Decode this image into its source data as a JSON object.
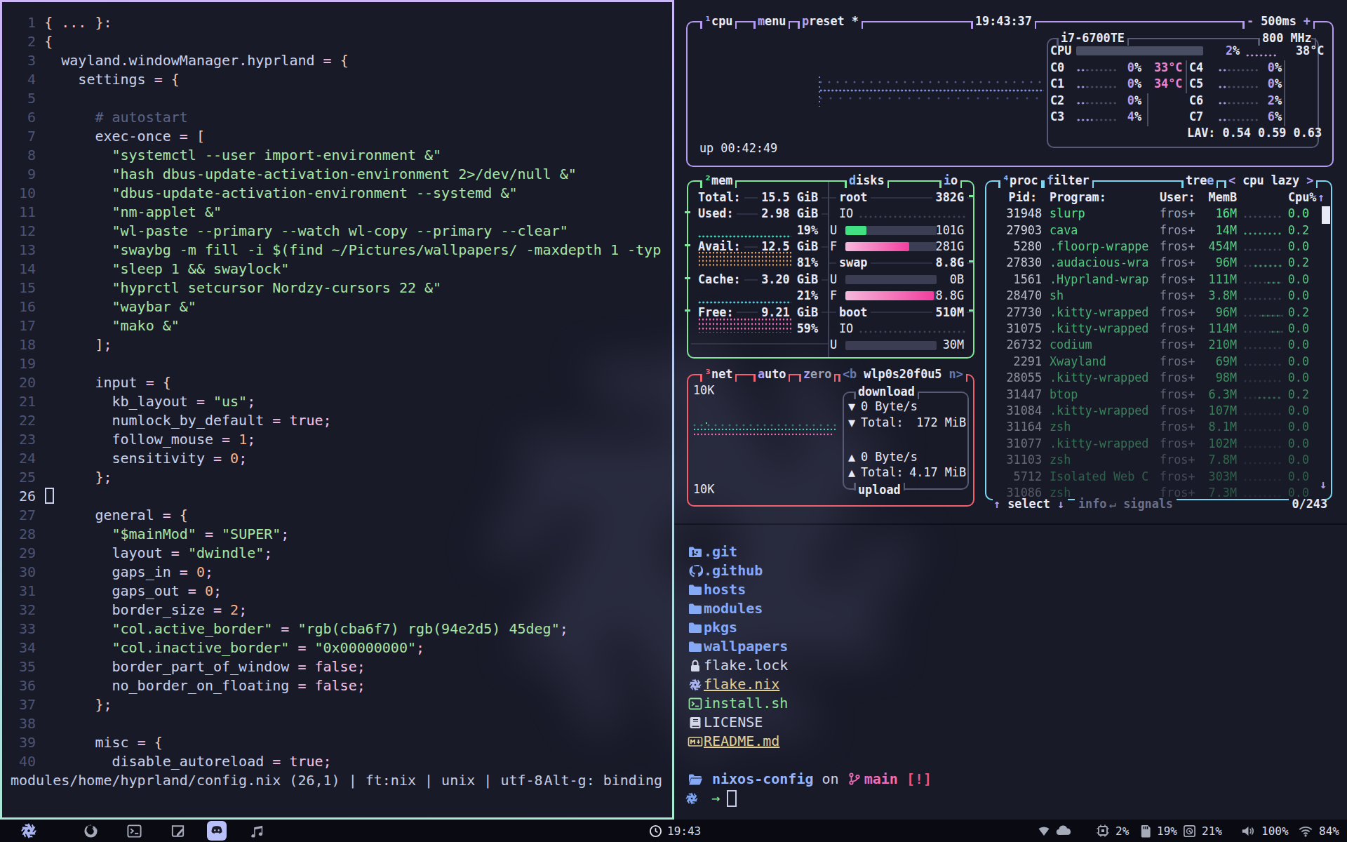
{
  "colors": {
    "active_border_top": "#cdb5f6",
    "active_border_bottom": "#a8ecd3",
    "cpu_box_border": "#b79bf0",
    "mem_box_border": "#7fe69a",
    "net_box_border": "#f4606d",
    "proc_box_border": "#7cd5f1",
    "sub_box_border": "#565a75",
    "meter_green": "#41e083",
    "meter_pink_light": "#f7b8dc",
    "meter_pink": "#f23e9e",
    "graph_teal": "#3fd2b4",
    "graph_orange": "#f0a35c",
    "graph_pink": "#ef6eb8",
    "graph_blue": "#8b97e8",
    "accent_lavender": "#b2a0f0"
  },
  "editor": {
    "lines": [
      [
        [
          "br",
          "{ "
        ],
        [
          "pink",
          "..."
        ],
        [
          "br",
          " }"
        ],
        [
          "pink",
          ":"
        ]
      ],
      [
        [
          "br",
          "{"
        ]
      ],
      [
        [
          "id",
          "  wayland"
        ],
        [
          "pink",
          "."
        ],
        [
          "id",
          "windowManager"
        ],
        [
          "pink",
          "."
        ],
        [
          "id",
          "hyprland"
        ],
        [
          "pink",
          " = "
        ],
        [
          "br",
          "{"
        ]
      ],
      [
        [
          "id",
          "    settings"
        ],
        [
          "pink",
          " = "
        ],
        [
          "br",
          "{"
        ]
      ],
      [],
      [
        [
          "com",
          "      # autostart"
        ]
      ],
      [
        [
          "id",
          "      exec-once"
        ],
        [
          "pink",
          " = "
        ],
        [
          "br",
          "["
        ]
      ],
      [
        [
          "str",
          "        \"systemctl --user import-environment &\""
        ]
      ],
      [
        [
          "str",
          "        \"hash dbus-update-activation-environment 2>/dev/null &\""
        ]
      ],
      [
        [
          "str",
          "        \"dbus-update-activation-environment --systemd &\""
        ]
      ],
      [
        [
          "str",
          "        \"nm-applet &\""
        ]
      ],
      [
        [
          "str",
          "        \"wl-paste --primary --watch wl-copy --primary --clear\""
        ]
      ],
      [
        [
          "str",
          "        \"swaybg -m fill -i $(find ~/Pictures/wallpapers/ -maxdepth 1 -typ"
        ]
      ],
      [
        [
          "str",
          "        \"sleep 1 && swaylock\""
        ]
      ],
      [
        [
          "str",
          "        \"hyprctl setcursor Nordzy-cursors 22 &\""
        ]
      ],
      [
        [
          "str",
          "        \"waybar &\""
        ]
      ],
      [
        [
          "str",
          "        \"mako &\""
        ]
      ],
      [
        [
          "br",
          "      ]"
        ],
        [
          "pink",
          ";"
        ]
      ],
      [],
      [
        [
          "id",
          "      input"
        ],
        [
          "pink",
          " = "
        ],
        [
          "br",
          "{"
        ]
      ],
      [
        [
          "id",
          "        kb_layout"
        ],
        [
          "pink",
          " = "
        ],
        [
          "str",
          "\"us\""
        ],
        [
          "pink",
          ";"
        ]
      ],
      [
        [
          "id",
          "        numlock_by_default"
        ],
        [
          "pink",
          " = "
        ],
        [
          "pink",
          "true"
        ],
        [
          "pink",
          ";"
        ]
      ],
      [
        [
          "id",
          "        follow_mouse"
        ],
        [
          "pink",
          " = "
        ],
        [
          "num",
          "1"
        ],
        [
          "pink",
          ";"
        ]
      ],
      [
        [
          "id",
          "        sensitivity"
        ],
        [
          "pink",
          " = "
        ],
        [
          "num",
          "0"
        ],
        [
          "pink",
          ";"
        ]
      ],
      [
        [
          "br",
          "      }"
        ],
        [
          "pink",
          ";"
        ]
      ],
      [],
      [
        [
          "id",
          "      general"
        ],
        [
          "pink",
          " = "
        ],
        [
          "br",
          "{"
        ]
      ],
      [
        [
          "str",
          "        \"$mainMod\""
        ],
        [
          "pink",
          " = "
        ],
        [
          "str",
          "\"SUPER\""
        ],
        [
          "pink",
          ";"
        ]
      ],
      [
        [
          "id",
          "        layout"
        ],
        [
          "pink",
          " = "
        ],
        [
          "str",
          "\"dwindle\""
        ],
        [
          "pink",
          ";"
        ]
      ],
      [
        [
          "id",
          "        gaps_in"
        ],
        [
          "pink",
          " = "
        ],
        [
          "num",
          "0"
        ],
        [
          "pink",
          ";"
        ]
      ],
      [
        [
          "id",
          "        gaps_out"
        ],
        [
          "pink",
          " = "
        ],
        [
          "num",
          "0"
        ],
        [
          "pink",
          ";"
        ]
      ],
      [
        [
          "id",
          "        border_size"
        ],
        [
          "pink",
          " = "
        ],
        [
          "num",
          "2"
        ],
        [
          "pink",
          ";"
        ]
      ],
      [
        [
          "str",
          "        \"col.active_border\""
        ],
        [
          "pink",
          " = "
        ],
        [
          "str",
          "\"rgb(cba6f7) rgb(94e2d5) 45deg\""
        ],
        [
          "pink",
          ";"
        ]
      ],
      [
        [
          "str",
          "        \"col.inactive_border\""
        ],
        [
          "pink",
          " = "
        ],
        [
          "str",
          "\"0x00000000\""
        ],
        [
          "pink",
          ";"
        ]
      ],
      [
        [
          "id",
          "        border_part_of_window"
        ],
        [
          "pink",
          " = "
        ],
        [
          "pink",
          "false"
        ],
        [
          "pink",
          ";"
        ]
      ],
      [
        [
          "id",
          "        no_border_on_floating"
        ],
        [
          "pink",
          " = "
        ],
        [
          "pink",
          "false"
        ],
        [
          "pink",
          ";"
        ]
      ],
      [
        [
          "br",
          "      }"
        ],
        [
          "pink",
          ";"
        ]
      ],
      [],
      [
        [
          "id",
          "      misc"
        ],
        [
          "pink",
          " = "
        ],
        [
          "br",
          "{"
        ]
      ],
      [
        [
          "id",
          "        disable_autoreload"
        ],
        [
          "pink",
          " = "
        ],
        [
          "pink",
          "true"
        ],
        [
          "pink",
          ";"
        ]
      ]
    ],
    "cursor_line": 26,
    "status_left": "modules/home/hyprland/config.nix (26,1) | ft:nix | unix | utf-8",
    "status_right": "Alt-g: binding"
  },
  "btop": {
    "cpu_box": {
      "titles": [
        {
          "key": "1",
          "rest": "cpu"
        },
        {
          "key": "m",
          "rest": "enu"
        },
        {
          "key": "p",
          "rest": "reset *"
        }
      ],
      "clock": "19:43:37",
      "interval_minus": "-",
      "interval": "500ms",
      "interval_plus": "+",
      "uptime": "up 00:42:49",
      "cpu_name": "i7-6700TE",
      "freq": "800 MHz",
      "total_label": "CPU",
      "total_pct_num": "2",
      "total_pct_sign": "%",
      "total_temp": "38°C",
      "cores": [
        {
          "name": "C0",
          "pct": "0",
          "temp": "33°C"
        },
        {
          "name": "C1",
          "pct": "0",
          "temp": "34°C"
        },
        {
          "name": "C2",
          "pct": "0",
          "temp": ""
        },
        {
          "name": "C3",
          "pct": "4",
          "temp": ""
        },
        {
          "name": "C4",
          "pct": "0",
          "temp": ""
        },
        {
          "name": "C5",
          "pct": "0",
          "temp": ""
        },
        {
          "name": "C6",
          "pct": "2",
          "temp": ""
        },
        {
          "name": "C7",
          "pct": "6",
          "temp": ""
        }
      ],
      "load_avg": "LAV: 0.54 0.59 0.63"
    },
    "mem_box": {
      "titles": [
        {
          "key": "2",
          "rest": "mem"
        },
        {
          "key": "d",
          "rest": "isks"
        },
        {
          "key": "i",
          "rest": "o"
        }
      ],
      "stats": [
        {
          "label": "Total:",
          "value": "15.5 GiB",
          "pct": "",
          "graph": ""
        },
        {
          "label": "Used:",
          "value": "2.98 GiB",
          "pct": "19%",
          "graph": "teal"
        },
        {
          "label": "Avail:",
          "value": "12.5 GiB",
          "pct": "81%",
          "graph": "orange"
        },
        {
          "label": "Cache:",
          "value": "3.20 GiB",
          "pct": "21%",
          "graph": "teal2"
        },
        {
          "label": "Free:",
          "value": "9.21 GiB",
          "pct": "59%",
          "graph": "pink"
        }
      ],
      "disks": [
        {
          "name": "root",
          "size": "382G",
          "io": true,
          "bars": [
            {
              "label": "U",
              "fill": 0.23,
              "color": "green",
              "value": "101G"
            },
            {
              "label": "F",
              "fill": 0.7,
              "color": "pink",
              "value": "281G"
            }
          ]
        },
        {
          "name": "swap",
          "size": "8.8G",
          "io": false,
          "bars": [
            {
              "label": "U",
              "fill": 0,
              "color": "none",
              "value": "0B"
            },
            {
              "label": "F",
              "fill": 0.97,
              "color": "pink",
              "value": "8.8G"
            }
          ]
        },
        {
          "name": "boot",
          "size": "510M",
          "io": true,
          "bars": [
            {
              "label": "U",
              "fill": 0,
              "color": "none",
              "value": "30M"
            }
          ]
        }
      ]
    },
    "net_box": {
      "titles": [
        {
          "key": "3",
          "rest": "net"
        },
        {
          "key": "a",
          "rest": "uto"
        },
        {
          "key": "z",
          "rest": "ero"
        }
      ],
      "iface_prev": "<b",
      "iface": "wlp0s20f0u5",
      "iface_next": "n>",
      "scale_top": "10K",
      "scale_bottom": "10K",
      "download_label": "download",
      "upload_label": "upload",
      "down_arrow": "▼",
      "up_arrow": "▲",
      "down_speed": "0 Byte/s",
      "down_total_label": "Total:",
      "down_total": "172 MiB",
      "up_speed": "0 Byte/s",
      "up_total_label": "Total:",
      "up_total": "4.17 MiB"
    },
    "proc_box": {
      "titles": [
        {
          "key": "4",
          "rest": "proc"
        },
        {
          "key": "f",
          "rest": "ilter"
        }
      ],
      "tree_pre": "tre",
      "tree_key": "e",
      "mode_open": "<",
      "mode": " cpu lazy ",
      "mode_close": ">",
      "header": {
        "pid": "Pid:",
        "program": "Program:",
        "user": "User:",
        "memb": "MemB",
        "cpu": "Cpu%",
        "sort_arrow": "↑"
      },
      "rows": [
        {
          "pid": "31948",
          "program": "slurp",
          "user": "fros+",
          "memb": "16M",
          "cpu": "0.0",
          "g": 0
        },
        {
          "pid": "27903",
          "program": "cava",
          "user": "fros+",
          "memb": "14M",
          "cpu": "0.2",
          "g": 55
        },
        {
          "pid": "5280",
          "program": ".floorp-wrappe",
          "user": "fros+",
          "memb": "454M",
          "cpu": "0.0",
          "g": 0
        },
        {
          "pid": "27830",
          "program": ".audacious-wra",
          "user": "fros+",
          "memb": "96M",
          "cpu": "0.2",
          "g": 40
        },
        {
          "pid": "1561",
          "program": ".Hyprland-wrap",
          "user": "fros+",
          "memb": "111M",
          "cpu": "0.0",
          "g": 22
        },
        {
          "pid": "28470",
          "program": "sh",
          "user": "fros+",
          "memb": "3.8M",
          "cpu": "0.0",
          "g": 0
        },
        {
          "pid": "27730",
          "program": ".kitty-wrapped",
          "user": "fros+",
          "memb": "96M",
          "cpu": "0.2",
          "g": 30
        },
        {
          "pid": "31075",
          "program": ".kitty-wrapped",
          "user": "fros+",
          "memb": "114M",
          "cpu": "0.0",
          "g": 16
        },
        {
          "pid": "26732",
          "program": "codium",
          "user": "fros+",
          "memb": "210M",
          "cpu": "0.0",
          "g": 0
        },
        {
          "pid": "2291",
          "program": "Xwayland",
          "user": "fros+",
          "memb": "69M",
          "cpu": "0.0",
          "g": 0
        },
        {
          "pid": "28055",
          "program": ".kitty-wrapped",
          "user": "fros+",
          "memb": "98M",
          "cpu": "0.0",
          "g": 0
        },
        {
          "pid": "31447",
          "program": "btop",
          "user": "fros+",
          "memb": "6.3M",
          "cpu": "0.2",
          "g": 35
        },
        {
          "pid": "31084",
          "program": ".kitty-wrapped",
          "user": "fros+",
          "memb": "107M",
          "cpu": "0.0",
          "g": 0
        },
        {
          "pid": "31164",
          "program": "zsh",
          "user": "fros+",
          "memb": "8.1M",
          "cpu": "0.0",
          "g": 0
        },
        {
          "pid": "31077",
          "program": ".kitty-wrapped",
          "user": "fros+",
          "memb": "102M",
          "cpu": "0.0",
          "g": 0
        },
        {
          "pid": "31103",
          "program": "zsh",
          "user": "fros+",
          "memb": "7.8M",
          "cpu": "0.0",
          "g": 0
        },
        {
          "pid": "5712",
          "program": "Isolated Web C",
          "user": "fros+",
          "memb": "303M",
          "cpu": "0.0",
          "g": 0
        },
        {
          "pid": "31086",
          "program": "zsh",
          "user": "fros+",
          "memb": "7.3M",
          "cpu": "0.0",
          "g": 0
        }
      ],
      "footer": {
        "up": "↑",
        "select": "select",
        "down": "↓",
        "info": "info",
        "enter": "↵",
        "signals": "signals",
        "count": "0/243",
        "scroll_down": "↓"
      }
    }
  },
  "terminal": {
    "files": [
      {
        "icon": "git-folder-icon",
        "name": ".git",
        "cls": "dirname"
      },
      {
        "icon": "github-icon",
        "name": ".github",
        "cls": "dirname"
      },
      {
        "icon": "folder-icon",
        "name": "hosts",
        "cls": "dirname"
      },
      {
        "icon": "folder-icon",
        "name": "modules",
        "cls": "dirname"
      },
      {
        "icon": "folder-icon",
        "name": "pkgs",
        "cls": "dirname"
      },
      {
        "icon": "folder-icon",
        "name": "wallpapers",
        "cls": "dirname"
      },
      {
        "icon": "lock-icon",
        "name": "flake.lock",
        "cls": "filewhite"
      },
      {
        "icon": "snowflake-icon",
        "name": "flake.nix",
        "cls": "fileyellow"
      },
      {
        "icon": "shell-icon",
        "name": "install.sh",
        "cls": "filegreen"
      },
      {
        "icon": "book-icon",
        "name": "LICENSE",
        "cls": "filewhite"
      },
      {
        "icon": "markdown-icon",
        "name": "README.md",
        "cls": "fileyellow"
      }
    ],
    "prompt": {
      "dir": "nixos-config",
      "on": "on",
      "branch": "main",
      "dirty": "[!]",
      "arrow": "→"
    }
  },
  "bar": {
    "launcher": "nixos-logo-icon",
    "taskbar": [
      "firefox-icon",
      "terminal-icon",
      "notes-icon",
      "discord-icon",
      "music-icon"
    ],
    "clock": "19:43",
    "modules": [
      {
        "icon": "wifi-fan-icon",
        "value": ""
      },
      {
        "icon": "cloud-icon",
        "value": ""
      },
      {
        "icon": "cpu-chip-icon",
        "value": "2%"
      },
      {
        "icon": "memory-icon",
        "value": "19%"
      },
      {
        "icon": "disk-icon",
        "value": "21%"
      },
      {
        "icon": "volume-icon",
        "value": "100%"
      },
      {
        "icon": "wifi-icon",
        "value": "84%"
      }
    ]
  }
}
